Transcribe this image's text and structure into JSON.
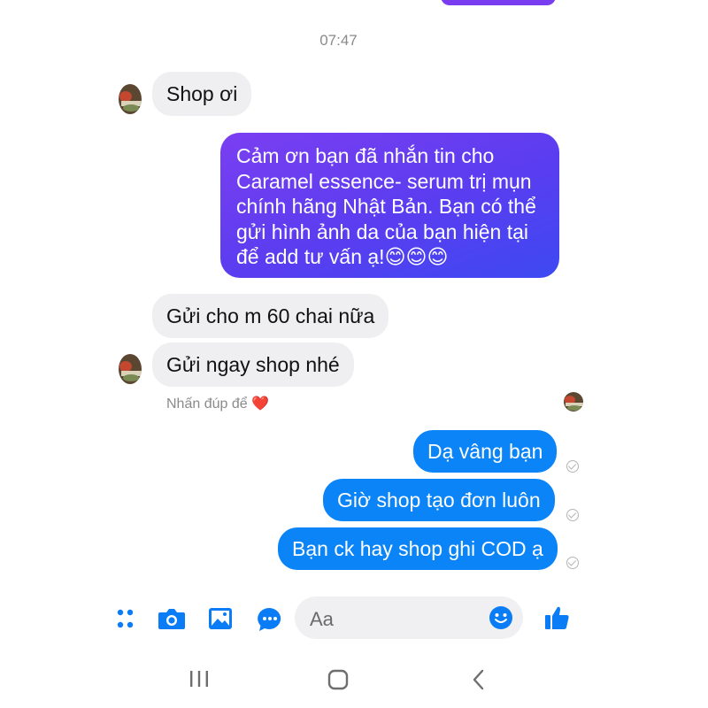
{
  "timestamp": "07:47",
  "messages": {
    "in1": "Shop ơi",
    "out_long": "Cảm ơn bạn đã nhắn tin cho Caramel essence- serum trị mụn chính hãng Nhật Bản. Bạn có thể gửi hình ảnh da của bạn hiện tại để add tư vấn ạ!😊😊😊",
    "out_long_lines": [
      "Cảm ơn bạn đã nhắn tin cho",
      "Caramel essence- serum trị mụn",
      "chính hãng Nhật Bản. Bạn có thể",
      "gửi hình ảnh da của bạn hiện tại",
      "để add tư vấn ạ!😊😊😊"
    ],
    "in2": "Gửi cho m 60 chai nữa",
    "in3": "Gửi ngay shop nhé",
    "reaction_hint": "Nhấn đúp để ❤️",
    "out1": "Dạ vâng bạn",
    "out2": "Giờ shop tạo đơn luôn",
    "out3": "Bạn ck hay shop ghi COD ạ"
  },
  "composer": {
    "placeholder": "Aa"
  },
  "icons": {
    "toolbar": [
      "menu-dots-icon",
      "camera-icon",
      "image-icon",
      "chat-icon",
      "emoji-icon",
      "thumbs-up-icon"
    ],
    "nav": [
      "recent-apps-icon",
      "home-icon",
      "back-icon"
    ]
  },
  "colors": {
    "outgoing_blue": "#0b84f7",
    "gradient_start": "#7b3ef1",
    "gradient_end": "#3d49f2",
    "incoming_gray": "#efeff1",
    "toolbar_blue": "#0a7cf5"
  }
}
